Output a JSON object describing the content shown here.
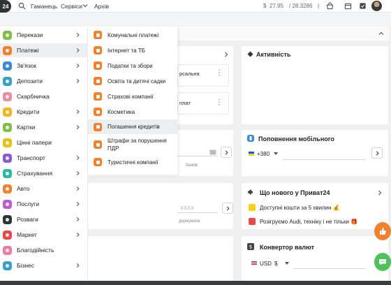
{
  "topbar": {
    "logo_text": "24",
    "link_main": "Гаманець",
    "link_services": "Сервіси",
    "link_archive": "Архів",
    "rate_usd_symbol": "$",
    "rate_usd": "27.95",
    "rate_eur": "/ 28.3286",
    "rate_separator": "|"
  },
  "menu": {
    "items": [
      {
        "label": "Перекази",
        "color": "#7cc04a",
        "chevron": true
      },
      {
        "label": "Платежі",
        "color": "#f0812e",
        "chevron": true
      },
      {
        "label": "Зв'язок",
        "color": "#3b8ad8",
        "chevron": true
      },
      {
        "label": "Депозити",
        "color": "#3aa0c8",
        "chevron": true
      },
      {
        "label": "Скарбничка",
        "color": "#f08aa0",
        "chevron": false
      },
      {
        "label": "Кредити",
        "color": "#f2b61c",
        "chevron": true
      },
      {
        "label": "Картки",
        "color": "#7cc04a",
        "chevron": true
      },
      {
        "label": "Цінні папери",
        "color": "#e8c01c",
        "chevron": false
      },
      {
        "label": "Транспорт",
        "color": "#8a5ad0",
        "chevron": true
      },
      {
        "label": "Страхування",
        "color": "#2fb8a0",
        "chevron": true
      },
      {
        "label": "Авто",
        "color": "#f0812e",
        "chevron": true
      },
      {
        "label": "Послуги",
        "color": "#c05ad0",
        "chevron": true
      },
      {
        "label": "Розваги",
        "color": "#2f3237",
        "chevron": true
      },
      {
        "label": "Маркет",
        "color": "#e84a4a",
        "chevron": true
      },
      {
        "label": "Благодійність",
        "color": "#f07aa0",
        "chevron": false
      },
      {
        "label": "Бізнес",
        "color": "#3aa0c8",
        "chevron": true
      }
    ]
  },
  "submenu": {
    "items": [
      {
        "label": "Комунальні платежі"
      },
      {
        "label": "Інтернет та ТБ"
      },
      {
        "label": "Податки та збори"
      },
      {
        "label": "Освіта та дитячі садки"
      },
      {
        "label": "Страхові компанії"
      },
      {
        "label": "Косметика"
      },
      {
        "label": "Погашення кредитів"
      },
      {
        "label": "Штрафи за порушення ПДР"
      },
      {
        "label": "Туристичні компанії"
      }
    ]
  },
  "background": {
    "partial_text_1": "рсальна",
    "partial_text_2": "плат",
    "partial_banks": "банків",
    "partial_card_mask": "XXXX",
    "partial_recipient": "держувача"
  },
  "activity": {
    "title": "Активність"
  },
  "mobile": {
    "title": "Поповнення мобільного",
    "country_code": "+380",
    "flag_colors": [
      "#1c5bd0",
      "#f7d21c"
    ]
  },
  "news": {
    "title": "Що нового у Приват24",
    "line1": "Доступні кошти за 5 хвилин 💰",
    "line2": "Розігруємо Audi, техніку і не тільки 🎁"
  },
  "converter": {
    "title": "Конвертор валют",
    "currency": "USD",
    "currency_symbol": "$"
  },
  "colors": {
    "accent": "#f0812e",
    "fab_like": "#f0812e",
    "fab_chat": "#4fc05a"
  }
}
